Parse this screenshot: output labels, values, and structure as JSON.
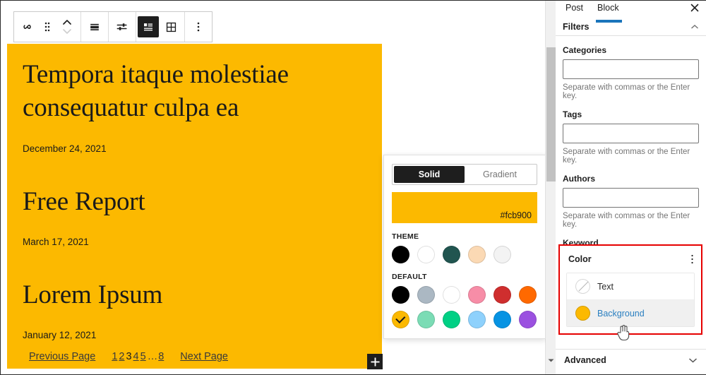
{
  "toolbar": {
    "buttons": [
      {
        "name": "query-loop-block-icon",
        "label": "Query Loop"
      },
      {
        "name": "drag-handle-icon",
        "label": "Drag"
      },
      {
        "name": "move-up-down-icon",
        "label": "Move up or down"
      },
      {
        "name": "align-icon",
        "label": "Align"
      },
      {
        "name": "display-settings-icon",
        "label": "Display settings"
      },
      {
        "name": "list-view-icon",
        "label": "List view"
      },
      {
        "name": "grid-view-icon",
        "label": "Grid view"
      },
      {
        "name": "more-options-icon",
        "label": "Options"
      }
    ]
  },
  "canvas": {
    "block_background": "#fcb900",
    "appender_label": "+",
    "posts": [
      {
        "title": "Tempora itaque molestiae consequatur culpa ea",
        "date": "December 24, 2021"
      },
      {
        "title": "Free Report",
        "date": "March 17, 2021"
      },
      {
        "title": "Lorem Ipsum",
        "date": "January 12, 2021"
      }
    ],
    "pagination": {
      "previous": "Previous Page",
      "next": "Next Page",
      "pages": [
        "1",
        "2",
        "3",
        "4",
        "5"
      ],
      "current": "3",
      "dots": "…",
      "last": "8"
    }
  },
  "color_popover": {
    "tabs": [
      {
        "label": "Solid",
        "selected": true
      },
      {
        "label": "Gradient",
        "selected": false
      }
    ],
    "current_hex": "#fcb900",
    "theme_label": "THEME",
    "default_label": "DEFAULT",
    "theme_swatches": [
      {
        "name": "black",
        "hex": "#000000"
      },
      {
        "name": "white",
        "hex": "#ffffff"
      },
      {
        "name": "dark-teal",
        "hex": "#215550"
      },
      {
        "name": "peach",
        "hex": "#fbd9b4"
      },
      {
        "name": "off-white",
        "hex": "#f3f3f3"
      }
    ],
    "default_swatches_row1": [
      {
        "name": "black",
        "hex": "#000000"
      },
      {
        "name": "cyan-bluish-gray",
        "hex": "#abb8c3"
      },
      {
        "name": "white",
        "hex": "#ffffff"
      },
      {
        "name": "pale-pink",
        "hex": "#f78da7"
      },
      {
        "name": "vivid-red",
        "hex": "#cf2e2e"
      },
      {
        "name": "luminous-vivid-orange",
        "hex": "#ff6900"
      }
    ],
    "default_swatches_row2": [
      {
        "name": "luminous-vivid-amber",
        "hex": "#fcb900",
        "selected": true
      },
      {
        "name": "light-green-cyan",
        "hex": "#7bdcb5"
      },
      {
        "name": "vivid-green-cyan",
        "hex": "#00d084"
      },
      {
        "name": "pale-cyan-blue",
        "hex": "#8ed1fc"
      },
      {
        "name": "vivid-cyan-blue",
        "hex": "#0693e3"
      },
      {
        "name": "vivid-purple",
        "hex": "#9b51e0"
      }
    ]
  },
  "sidebar": {
    "tabs": [
      {
        "label": "Post",
        "active": false
      },
      {
        "label": "Block",
        "active": true
      }
    ],
    "close_label": "Close settings",
    "filters": {
      "title": "Filters",
      "fields": [
        {
          "label": "Categories",
          "value": "",
          "help": "Separate with commas or the Enter key."
        },
        {
          "label": "Tags",
          "value": "",
          "help": "Separate with commas or the Enter key."
        },
        {
          "label": "Authors",
          "value": "",
          "help": "Separate with commas or the Enter key."
        },
        {
          "label": "Keyword",
          "value": "",
          "help": ""
        }
      ]
    },
    "color_panel": {
      "title": "Color",
      "items": [
        {
          "label": "Text",
          "swatch": "",
          "hovered": false
        },
        {
          "label": "Background",
          "swatch": "#fcb900",
          "hovered": true
        }
      ]
    },
    "advanced": {
      "title": "Advanced"
    }
  }
}
